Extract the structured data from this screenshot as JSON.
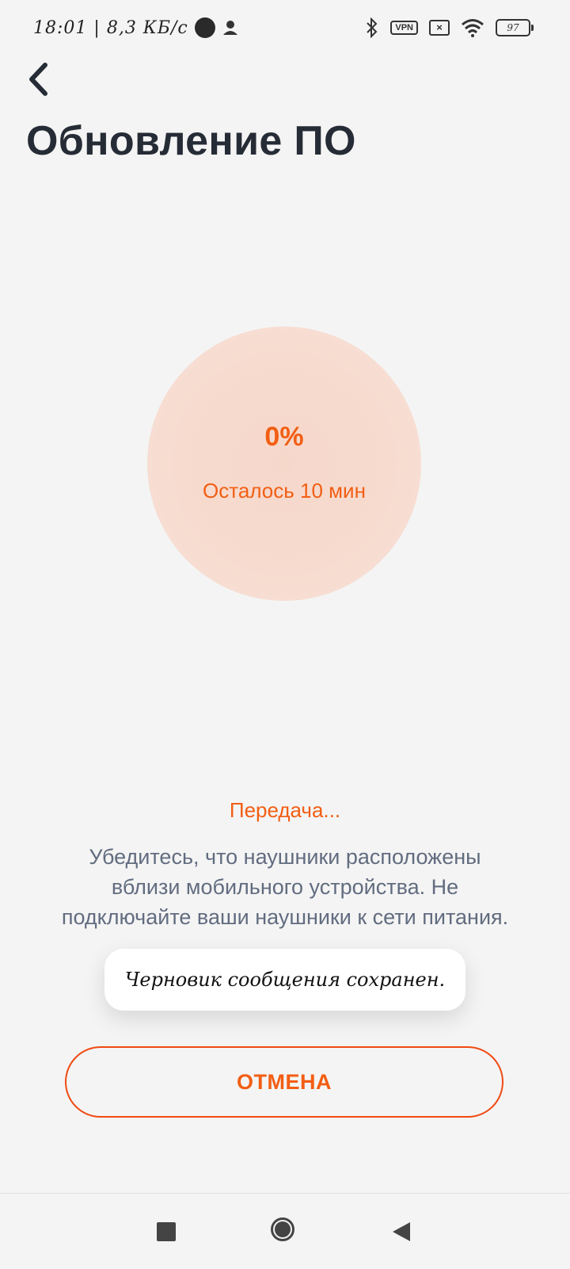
{
  "status_bar": {
    "time": "18:01",
    "separator": "|",
    "network_speed": "8,3 КБ/с",
    "vpn_label": "VPN",
    "battery_level": "97",
    "icons": [
      "record-dot-icon",
      "person-icon",
      "bluetooth-icon",
      "vpn-icon",
      "sim-off-icon",
      "wifi-icon",
      "battery-icon"
    ]
  },
  "header": {
    "back_icon": "chevron-left-icon",
    "title": "Обновление ПО"
  },
  "progress": {
    "percent_text": "0%",
    "value": 0,
    "remaining_text": "Осталось 10 мин"
  },
  "status": {
    "transfer_text": "Передача...",
    "description": "Убедитесь, что наушники расположены вблизи мобильного устройства. Не подключайте ваши наушники к сети питания."
  },
  "toast": {
    "text": "Черновик сообщения сохранен."
  },
  "actions": {
    "cancel_label": "ОТМЕНА"
  },
  "colors": {
    "accent": "#f25e13",
    "title": "#262c36",
    "description": "#626c80",
    "background": "#f4f4f4",
    "circle": "#f7dbcf"
  },
  "nav_bar": {
    "icons": [
      "recents-square-icon",
      "home-circle-icon",
      "back-triangle-icon"
    ]
  }
}
